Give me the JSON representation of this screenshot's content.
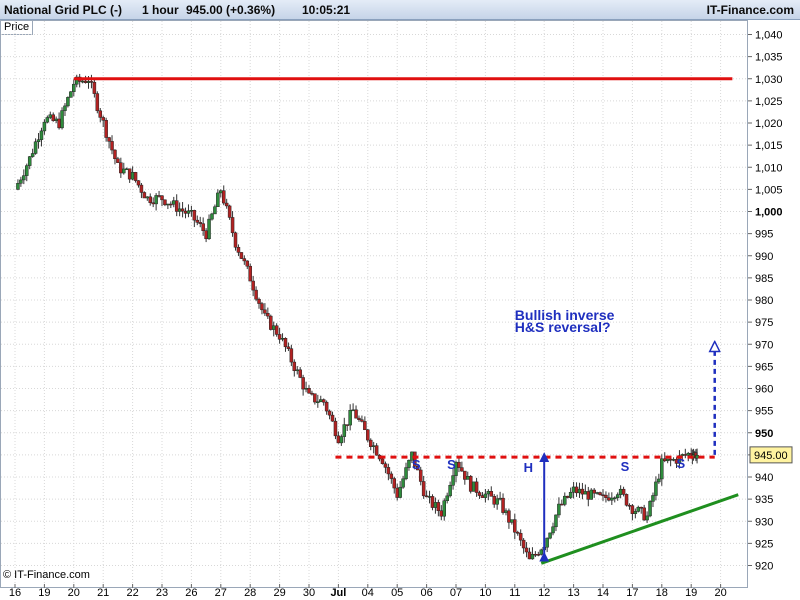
{
  "header": {
    "instrument": "National Grid PLC (-)",
    "interval": "1 hour",
    "quote": "945.00 (+0.36%)",
    "time": "10:05:21",
    "brand": "IT-Finance.com"
  },
  "panel_label": "Price",
  "footer": {
    "copyright": "© IT-Finance.com"
  },
  "colors": {
    "up_candle": "#2e8b3c",
    "down_candle": "#b22222",
    "resistance": "#e01010",
    "neckline": "#e01010",
    "trendline": "#1f8f1f",
    "annotation": "#1f2fbf",
    "price_box": "#fff3a0"
  },
  "chart_data": {
    "type": "candlestick",
    "title": "",
    "xlabel": "",
    "ylabel": "",
    "ylim": [
      917,
      1043
    ],
    "y_ticks": [
      1040,
      1035,
      1030,
      1025,
      1020,
      1015,
      1010,
      1005,
      1000,
      995,
      990,
      985,
      980,
      975,
      970,
      965,
      960,
      955,
      950,
      945,
      940,
      935,
      930,
      925,
      920
    ],
    "y_tick_labels": [
      "1,040",
      "1,035",
      "1,030",
      "1,025",
      "1,020",
      "1,015",
      "1,010",
      "1,005",
      "1,000",
      "995",
      "990",
      "985",
      "980",
      "975",
      "970",
      "965",
      "960",
      "955",
      "950",
      "945",
      "940",
      "935",
      "930",
      "925",
      "920"
    ],
    "y_tick_bold": [
      "1,000",
      "950"
    ],
    "x_labels": [
      "16",
      "19",
      "20",
      "21",
      "22",
      "23",
      "26",
      "27",
      "28",
      "29",
      "30",
      "Jul",
      "04",
      "05",
      "06",
      "07",
      "10",
      "11",
      "12",
      "13",
      "14",
      "17",
      "18",
      "19",
      "20"
    ],
    "x_bold": [
      "Jul"
    ],
    "last_price": 945.0,
    "last_price_label": "945.00",
    "session_close_path": [
      [
        0,
        1005
      ],
      [
        0.5,
        1012
      ],
      [
        1,
        1021
      ],
      [
        1.5,
        1020
      ],
      [
        2,
        1029
      ],
      [
        2.5,
        1030
      ],
      [
        3,
        1020
      ],
      [
        3.5,
        1010
      ],
      [
        4,
        1008
      ],
      [
        4.5,
        1003
      ],
      [
        5,
        1003
      ],
      [
        5.5,
        1001
      ],
      [
        6,
        999
      ],
      [
        6.5,
        995
      ],
      [
        7,
        1005
      ],
      [
        7.5,
        993
      ],
      [
        8,
        985
      ],
      [
        8.5,
        976
      ],
      [
        9,
        972
      ],
      [
        9.5,
        965
      ],
      [
        10,
        958
      ],
      [
        10.5,
        957
      ],
      [
        11,
        949
      ],
      [
        11.5,
        955
      ],
      [
        12,
        949
      ],
      [
        12.5,
        944
      ],
      [
        13,
        936
      ],
      [
        13.5,
        945
      ],
      [
        14,
        935
      ],
      [
        14.5,
        932
      ],
      [
        15,
        944
      ],
      [
        15.5,
        938
      ],
      [
        16,
        936
      ],
      [
        16.5,
        934
      ],
      [
        17,
        928
      ],
      [
        17.5,
        921
      ],
      [
        18,
        925
      ],
      [
        18.5,
        933
      ],
      [
        19,
        937
      ],
      [
        19.5,
        936
      ],
      [
        20,
        935
      ],
      [
        20.5,
        937
      ],
      [
        21,
        933
      ],
      [
        21.5,
        931
      ],
      [
        22,
        943
      ],
      [
        22.5,
        944
      ],
      [
        23,
        945.5
      ],
      [
        23.2,
        945
      ]
    ],
    "lines": [
      {
        "name": "resistance",
        "style": "solid",
        "from": [
          2,
          1030
        ],
        "to": [
          24.4,
          1030
        ]
      },
      {
        "name": "neckline",
        "style": "dashed",
        "from": [
          10.9,
          944.5
        ],
        "to": [
          23.8,
          944.5
        ]
      },
      {
        "name": "trendline",
        "style": "solid",
        "from": [
          17.9,
          920.5
        ],
        "to": [
          24.6,
          936
        ]
      },
      {
        "name": "head-depth-arrow",
        "style": "solid-arrow",
        "from": [
          18,
          922
        ],
        "to": [
          18,
          944.5
        ]
      },
      {
        "name": "target-arrow",
        "style": "dashed-arrow",
        "from": [
          23.8,
          945
        ],
        "to": [
          23.8,
          969.5
        ]
      }
    ],
    "annotations": [
      {
        "text": "Bullish inverse",
        "x": 17.0,
        "y": 976.5
      },
      {
        "text": "H&S reversal?",
        "x": 17.0,
        "y": 973.8
      },
      {
        "text": "S",
        "x": 13.5,
        "y": 942.3
      },
      {
        "text": "S",
        "x": 14.7,
        "y": 942.3
      },
      {
        "text": "H",
        "x": 17.3,
        "y": 941.5
      },
      {
        "text": "S",
        "x": 20.6,
        "y": 941.7
      },
      {
        "text": "S",
        "x": 22.5,
        "y": 942.5
      }
    ]
  }
}
